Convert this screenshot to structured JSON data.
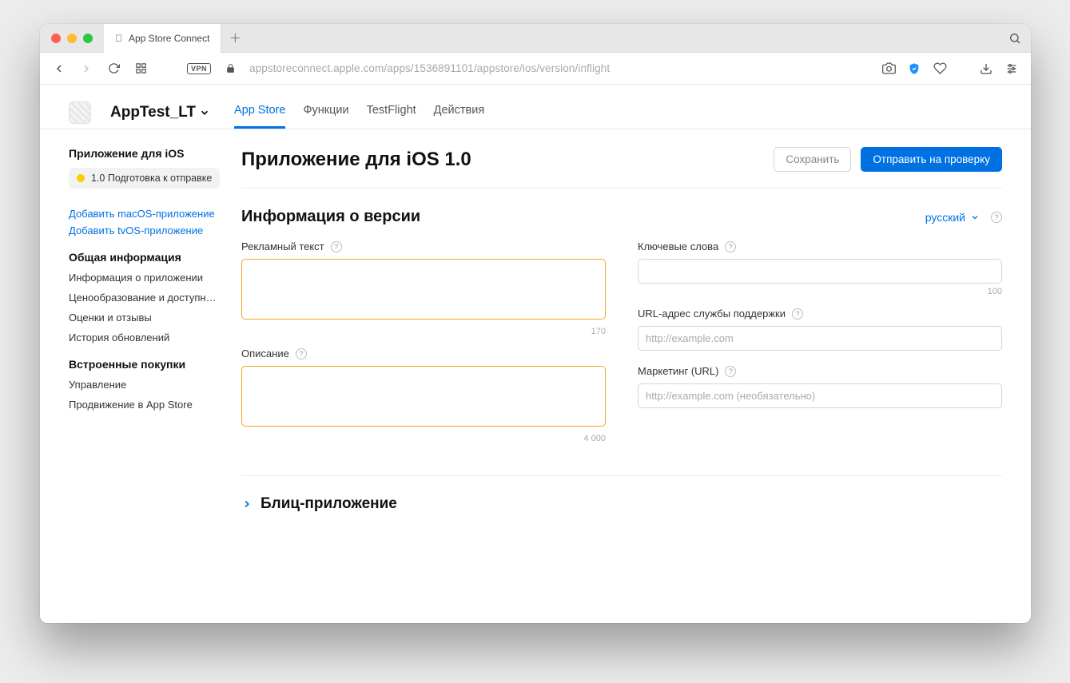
{
  "browser": {
    "tab_title": "App Store Connect",
    "url": "appstoreconnect.apple.com/apps/1536891101/appstore/ios/version/inflight"
  },
  "header": {
    "app_name": "AppTest_LT",
    "tabs": [
      "App Store",
      "Функции",
      "TestFlight",
      "Действия"
    ]
  },
  "sidebar": {
    "h1": "Приложение для iOS",
    "status": "1.0 Подготовка к отправке",
    "add_macos": "Добавить macOS-приложение",
    "add_tvos": "Добавить tvOS-приложение",
    "h2": "Общая информация",
    "general": [
      "Информация о приложении",
      "Ценообразование и доступно…",
      "Оценки и отзывы",
      "История обновлений"
    ],
    "h3": "Встроенные покупки",
    "iap": [
      "Управление",
      "Продвижение в App Store"
    ]
  },
  "page": {
    "title": "Приложение для iOS 1.0",
    "save": "Сохранить",
    "submit": "Отправить на проверку",
    "section_title": "Информация о версии",
    "language": "русский",
    "promo_label": "Рекламный текст",
    "promo_count": "170",
    "desc_label": "Описание",
    "desc_count": "4 000",
    "keywords_label": "Ключевые слова",
    "keywords_count": "100",
    "support_label": "URL-адрес службы поддержки",
    "support_placeholder": "http://example.com",
    "marketing_label": "Маркетинг (URL)",
    "marketing_placeholder": "http://example.com (необязательно)",
    "collapse_title": "Блиц-приложение"
  }
}
